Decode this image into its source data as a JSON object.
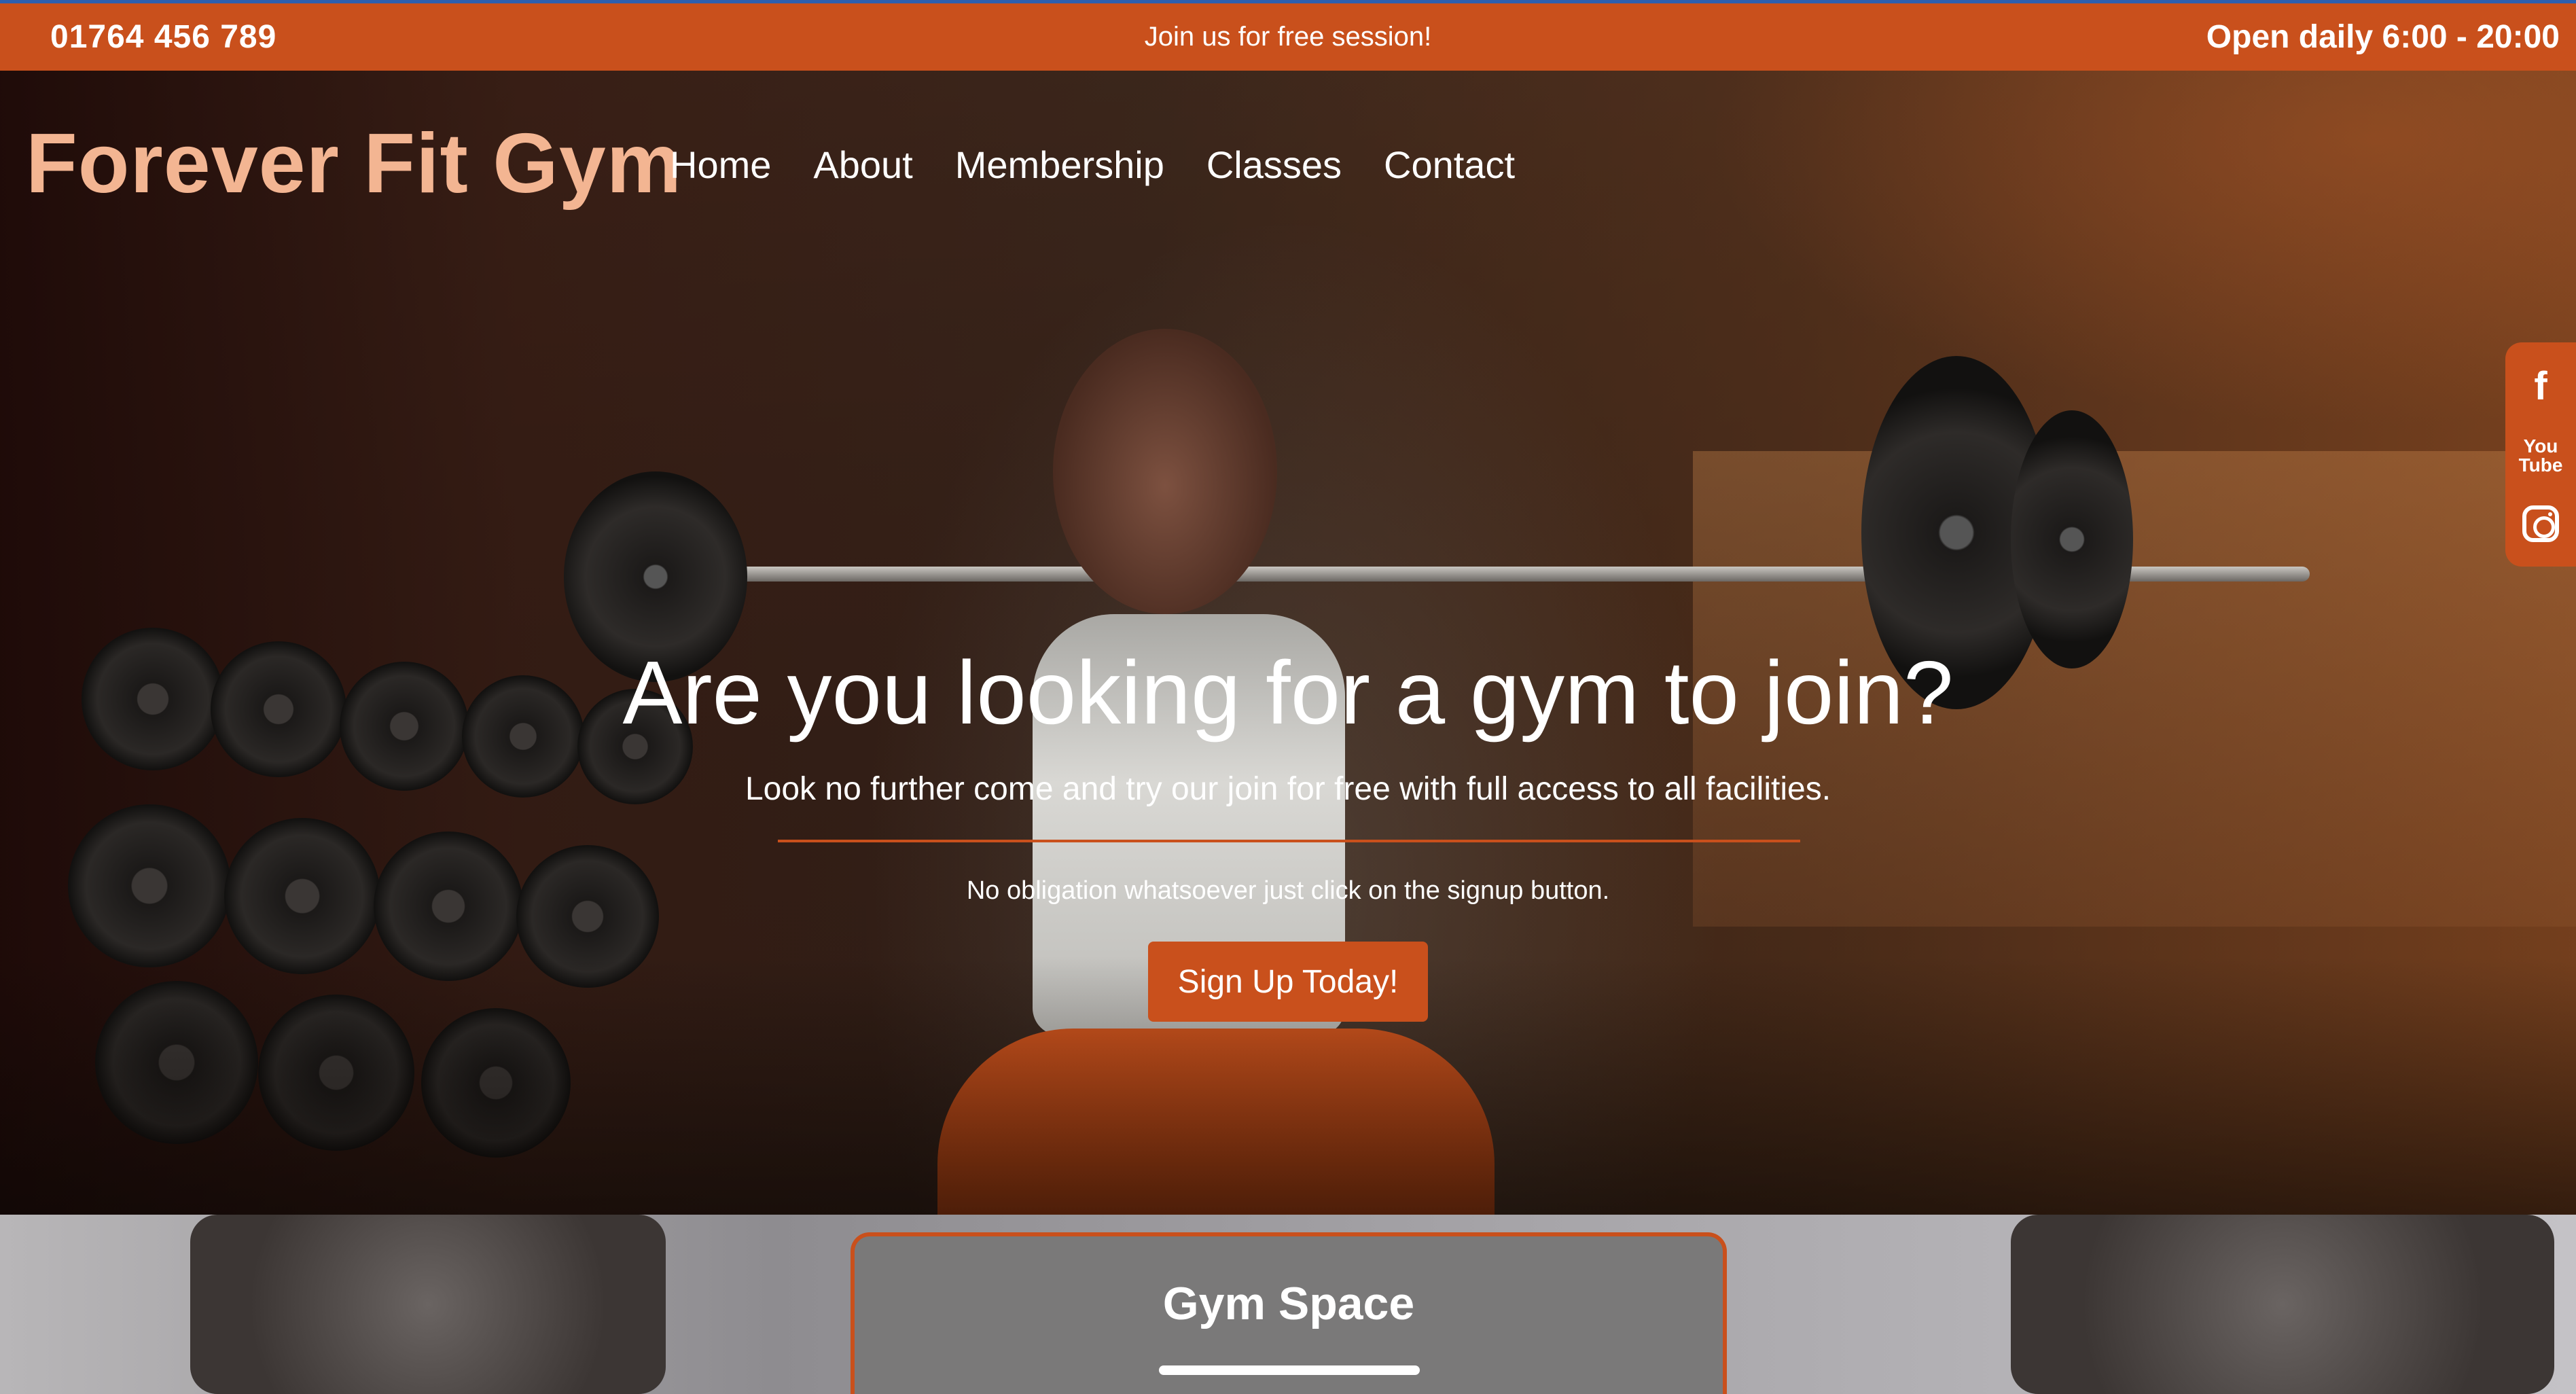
{
  "topbar": {
    "phone": "01764 456 789",
    "promo": "Join us for free session!",
    "hours": "Open daily 6:00 - 20:00"
  },
  "brand": {
    "logo": "Forever Fit Gym"
  },
  "nav": {
    "items": [
      "Home",
      "About",
      "Membership",
      "Classes",
      "Contact"
    ]
  },
  "hero": {
    "headline": "Are you looking for a gym to join?",
    "subline": "Look no further come and try our join for free with full access to all facilities.",
    "note": "No obligation whatsoever just click on the signup button.",
    "cta": "Sign Up Today!"
  },
  "social": {
    "facebook": "f",
    "youtube_top": "You",
    "youtube_bottom": "Tube",
    "icons": [
      "facebook-icon",
      "youtube-icon",
      "instagram-icon"
    ]
  },
  "section": {
    "title": "Gym Space"
  },
  "colors": {
    "accent": "#c9501c",
    "logo": "#f3b592",
    "card": "#7a7979"
  }
}
